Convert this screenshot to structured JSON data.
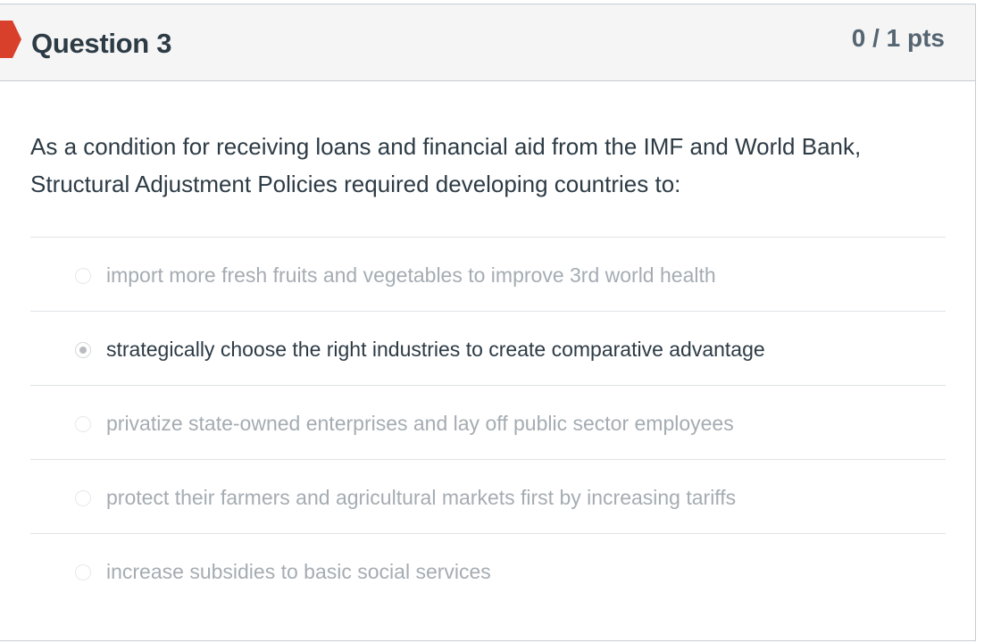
{
  "question": {
    "title": "Question 3",
    "points": "0 / 1 pts",
    "text": "As a condition for receiving loans and financial aid from the IMF and World Bank, Structural Adjustment Policies required developing countries to:",
    "flag_icon": "flag-icon",
    "flag_color": "#d9402b"
  },
  "answers": [
    {
      "label": "import more fresh fruits and vegetables to improve 3rd world health",
      "selected": false
    },
    {
      "label": "strategically choose the right industries to create comparative advantage",
      "selected": true
    },
    {
      "label": "privatize state-owned enterprises and lay off public sector employees",
      "selected": false
    },
    {
      "label": "protect their farmers and agricultural markets first by increasing tariffs",
      "selected": false
    },
    {
      "label": "increase subsidies to basic social services",
      "selected": false
    }
  ]
}
